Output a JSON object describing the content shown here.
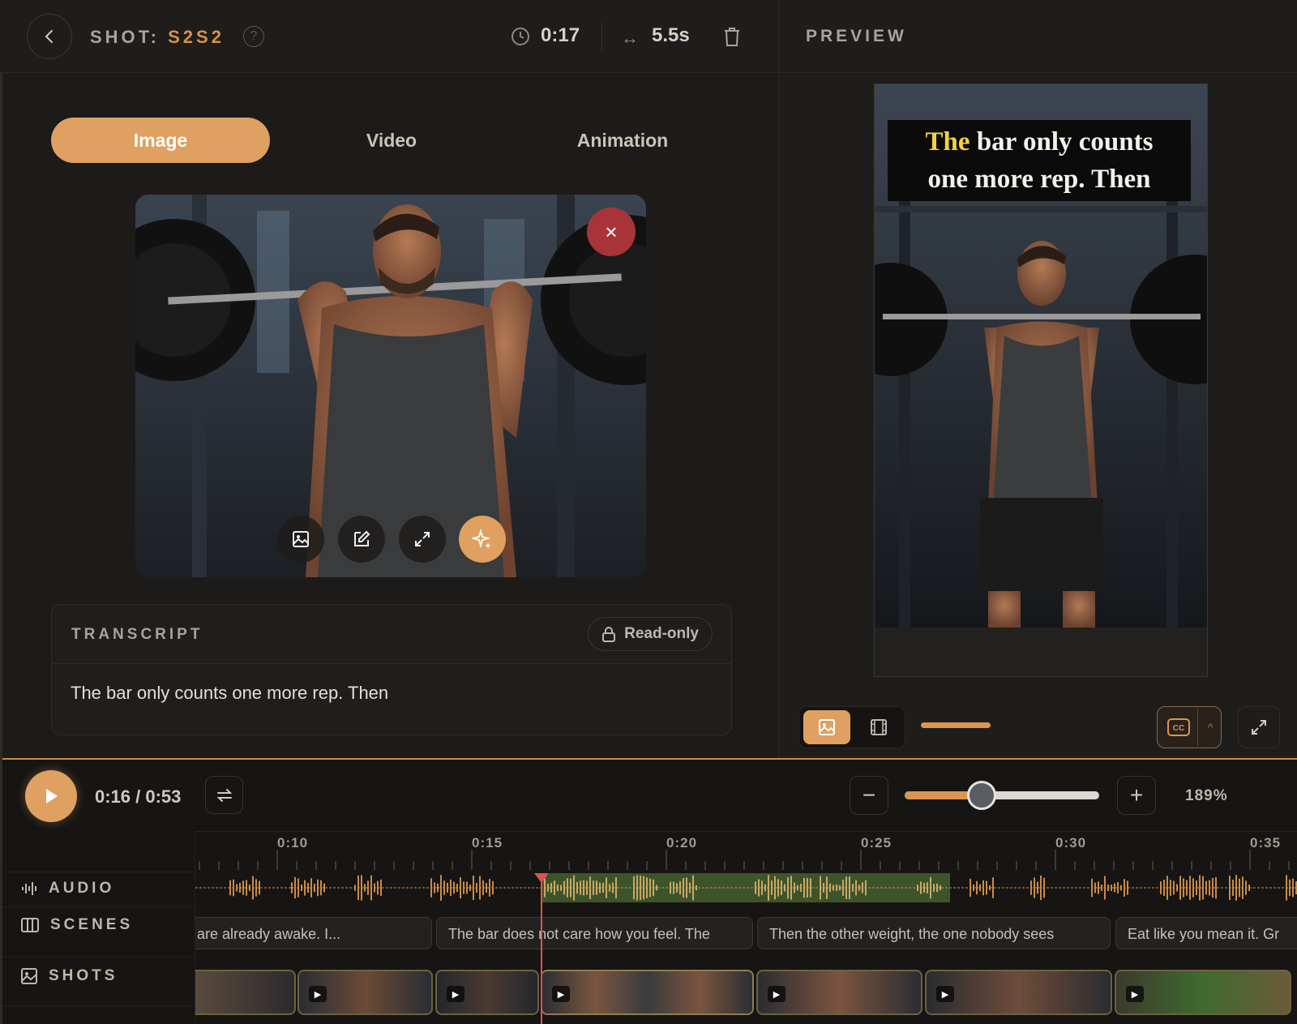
{
  "header": {
    "shot_prefix": "SHOT:",
    "shot_code": "S2S2",
    "help": "?",
    "current_time": "0:17",
    "duration": "5.5s",
    "arrow": "↔",
    "preview_title": "PREVIEW"
  },
  "tabs": [
    {
      "label": "Image",
      "active": true
    },
    {
      "label": "Video",
      "active": false
    },
    {
      "label": "Animation",
      "active": false
    }
  ],
  "image_card": {
    "close": "×"
  },
  "transcript": {
    "title": "TRANSCRIPT",
    "readonly_label": "Read-only",
    "text": "The bar only counts one more rep. Then"
  },
  "preview": {
    "caption_highlight": "The",
    "caption_line1_rest": " bar only counts",
    "caption_line2": "one more rep. Then",
    "cc_caret": "^"
  },
  "player": {
    "time": "0:16 / 0:53",
    "zoom_minus": "−",
    "zoom_plus": "+",
    "zoom_pct": "189%",
    "zoom_level": 0.4
  },
  "timeline": {
    "ticks": [
      "0:10",
      "0:15",
      "0:20",
      "0:25",
      "0:30",
      "0:35"
    ],
    "tracks": {
      "audio": "AUDIO",
      "scenes": "SCENES",
      "shots": "SHOTS"
    },
    "scenes": [
      "are already awake. I...",
      "The bar does not care how you feel. The",
      "Then the other weight, the one nobody sees",
      "Eat like you mean it. Gr"
    ],
    "play_glyph": "▶"
  },
  "colors": {
    "accent": "#dfa061",
    "danger": "#a8343a",
    "playhead": "#e0524f",
    "wave": "#c98a4a",
    "wave_active": "#4b6a33"
  }
}
